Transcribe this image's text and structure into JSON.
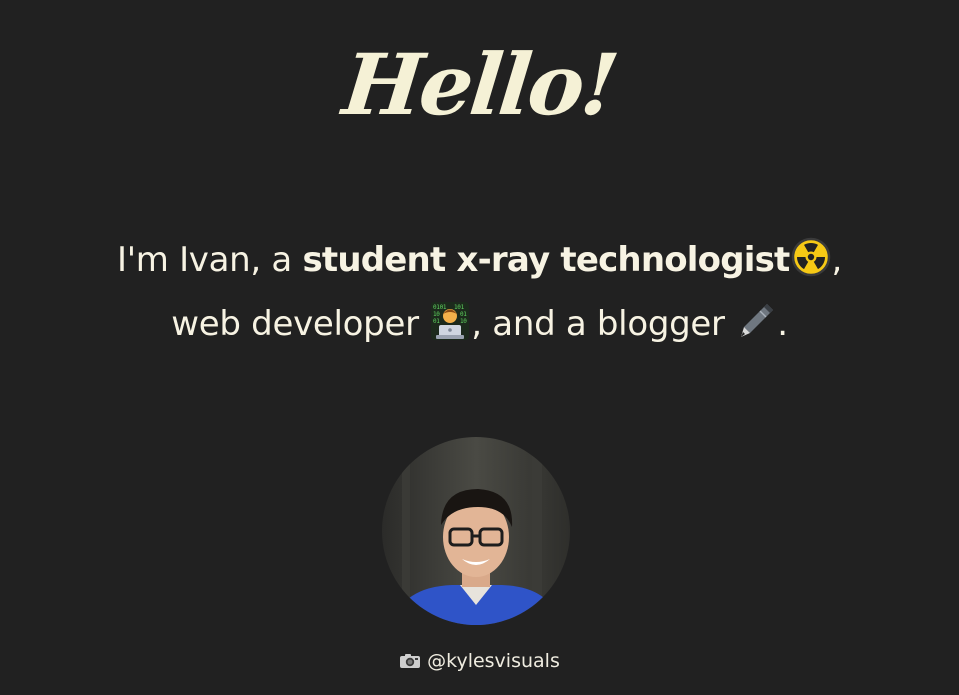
{
  "hero": {
    "greeting": "Hello!"
  },
  "intro": {
    "part1": "I'm Ivan, a ",
    "role1": "student x-ray technologist",
    "role1_icon": "radioactive-icon",
    "sep1": ",",
    "role2": "web developer ",
    "role2_icon": "technologist-icon",
    "sep2": ", and a blogger ",
    "role3_icon": "pen-icon",
    "end": "."
  },
  "avatar": {
    "alt": "Portrait photo of Ivan"
  },
  "credit": {
    "icon": "camera-icon",
    "handle": "@kylesvisuals"
  },
  "colors": {
    "background": "#212121",
    "text": "#f7f3e3",
    "greeting": "#f5f1d6"
  }
}
